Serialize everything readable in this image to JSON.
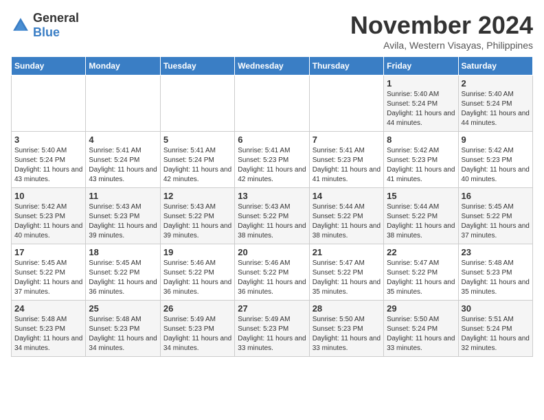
{
  "logo": {
    "general": "General",
    "blue": "Blue"
  },
  "title": {
    "month": "November 2024",
    "location": "Avila, Western Visayas, Philippines"
  },
  "weekdays": [
    "Sunday",
    "Monday",
    "Tuesday",
    "Wednesday",
    "Thursday",
    "Friday",
    "Saturday"
  ],
  "rows": [
    [
      {
        "day": "",
        "content": ""
      },
      {
        "day": "",
        "content": ""
      },
      {
        "day": "",
        "content": ""
      },
      {
        "day": "",
        "content": ""
      },
      {
        "day": "",
        "content": ""
      },
      {
        "day": "1",
        "content": "Sunrise: 5:40 AM\nSunset: 5:24 PM\nDaylight: 11 hours and 44 minutes."
      },
      {
        "day": "2",
        "content": "Sunrise: 5:40 AM\nSunset: 5:24 PM\nDaylight: 11 hours and 44 minutes."
      }
    ],
    [
      {
        "day": "3",
        "content": "Sunrise: 5:40 AM\nSunset: 5:24 PM\nDaylight: 11 hours and 43 minutes."
      },
      {
        "day": "4",
        "content": "Sunrise: 5:41 AM\nSunset: 5:24 PM\nDaylight: 11 hours and 43 minutes."
      },
      {
        "day": "5",
        "content": "Sunrise: 5:41 AM\nSunset: 5:24 PM\nDaylight: 11 hours and 42 minutes."
      },
      {
        "day": "6",
        "content": "Sunrise: 5:41 AM\nSunset: 5:23 PM\nDaylight: 11 hours and 42 minutes."
      },
      {
        "day": "7",
        "content": "Sunrise: 5:41 AM\nSunset: 5:23 PM\nDaylight: 11 hours and 41 minutes."
      },
      {
        "day": "8",
        "content": "Sunrise: 5:42 AM\nSunset: 5:23 PM\nDaylight: 11 hours and 41 minutes."
      },
      {
        "day": "9",
        "content": "Sunrise: 5:42 AM\nSunset: 5:23 PM\nDaylight: 11 hours and 40 minutes."
      }
    ],
    [
      {
        "day": "10",
        "content": "Sunrise: 5:42 AM\nSunset: 5:23 PM\nDaylight: 11 hours and 40 minutes."
      },
      {
        "day": "11",
        "content": "Sunrise: 5:43 AM\nSunset: 5:23 PM\nDaylight: 11 hours and 39 minutes."
      },
      {
        "day": "12",
        "content": "Sunrise: 5:43 AM\nSunset: 5:22 PM\nDaylight: 11 hours and 39 minutes."
      },
      {
        "day": "13",
        "content": "Sunrise: 5:43 AM\nSunset: 5:22 PM\nDaylight: 11 hours and 38 minutes."
      },
      {
        "day": "14",
        "content": "Sunrise: 5:44 AM\nSunset: 5:22 PM\nDaylight: 11 hours and 38 minutes."
      },
      {
        "day": "15",
        "content": "Sunrise: 5:44 AM\nSunset: 5:22 PM\nDaylight: 11 hours and 38 minutes."
      },
      {
        "day": "16",
        "content": "Sunrise: 5:45 AM\nSunset: 5:22 PM\nDaylight: 11 hours and 37 minutes."
      }
    ],
    [
      {
        "day": "17",
        "content": "Sunrise: 5:45 AM\nSunset: 5:22 PM\nDaylight: 11 hours and 37 minutes."
      },
      {
        "day": "18",
        "content": "Sunrise: 5:45 AM\nSunset: 5:22 PM\nDaylight: 11 hours and 36 minutes."
      },
      {
        "day": "19",
        "content": "Sunrise: 5:46 AM\nSunset: 5:22 PM\nDaylight: 11 hours and 36 minutes."
      },
      {
        "day": "20",
        "content": "Sunrise: 5:46 AM\nSunset: 5:22 PM\nDaylight: 11 hours and 36 minutes."
      },
      {
        "day": "21",
        "content": "Sunrise: 5:47 AM\nSunset: 5:22 PM\nDaylight: 11 hours and 35 minutes."
      },
      {
        "day": "22",
        "content": "Sunrise: 5:47 AM\nSunset: 5:22 PM\nDaylight: 11 hours and 35 minutes."
      },
      {
        "day": "23",
        "content": "Sunrise: 5:48 AM\nSunset: 5:23 PM\nDaylight: 11 hours and 35 minutes."
      }
    ],
    [
      {
        "day": "24",
        "content": "Sunrise: 5:48 AM\nSunset: 5:23 PM\nDaylight: 11 hours and 34 minutes."
      },
      {
        "day": "25",
        "content": "Sunrise: 5:48 AM\nSunset: 5:23 PM\nDaylight: 11 hours and 34 minutes."
      },
      {
        "day": "26",
        "content": "Sunrise: 5:49 AM\nSunset: 5:23 PM\nDaylight: 11 hours and 34 minutes."
      },
      {
        "day": "27",
        "content": "Sunrise: 5:49 AM\nSunset: 5:23 PM\nDaylight: 11 hours and 33 minutes."
      },
      {
        "day": "28",
        "content": "Sunrise: 5:50 AM\nSunset: 5:23 PM\nDaylight: 11 hours and 33 minutes."
      },
      {
        "day": "29",
        "content": "Sunrise: 5:50 AM\nSunset: 5:24 PM\nDaylight: 11 hours and 33 minutes."
      },
      {
        "day": "30",
        "content": "Sunrise: 5:51 AM\nSunset: 5:24 PM\nDaylight: 11 hours and 32 minutes."
      }
    ]
  ]
}
